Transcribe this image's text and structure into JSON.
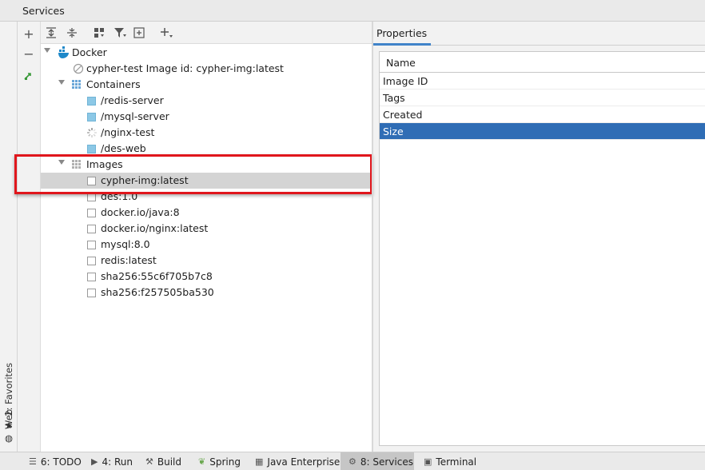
{
  "window": {
    "title": "Services"
  },
  "left_strip": {
    "web": "Web",
    "favorites": "2: Favorites"
  },
  "tree": {
    "root": "Docker",
    "image_id_row": "cypher-test Image id: cypher-img:latest",
    "containers_label": "Containers",
    "containers": [
      "/redis-server",
      "/mysql-server",
      "/nginx-test",
      "/des-web"
    ],
    "images_label": "Images",
    "images": [
      "cypher-img:latest",
      "des:1.0",
      "docker.io/java:8",
      "docker.io/nginx:latest",
      "mysql:8.0",
      "redis:latest",
      "sha256:55c6f705b7c8",
      "sha256:f257505ba530"
    ],
    "selected_image": "cypher-img:latest"
  },
  "properties": {
    "tab": "Properties",
    "header": "Name",
    "rows": [
      "Image ID",
      "Tags",
      "Created",
      "Size"
    ],
    "selected_row": "Size"
  },
  "bottom_bar": {
    "items": [
      "6: TODO",
      "4: Run",
      "Build",
      "Spring",
      "Java Enterprise",
      "8: Services",
      "Terminal"
    ],
    "active": "8: Services"
  },
  "colors": {
    "accent": "#4083c9",
    "selection": "#2f6db5",
    "highlight_box": "#e0161c",
    "container_icon": "#8cc8e6"
  },
  "icons": [
    "add-icon",
    "remove-icon",
    "expand-all-icon",
    "collapse-all-icon",
    "group-icon",
    "filter-icon",
    "new-icon",
    "add-dropdown-icon",
    "docker-icon",
    "grid-icon",
    "star-icon",
    "globe-icon"
  ]
}
